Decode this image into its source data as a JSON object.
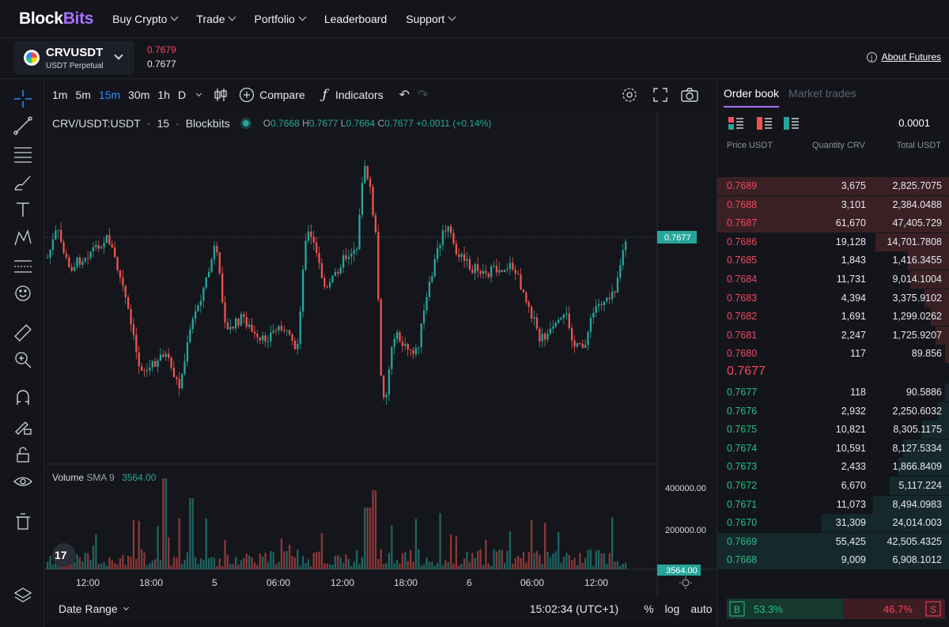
{
  "nav": {
    "logo_a": "Block",
    "logo_b": "Bits",
    "items": [
      "Buy Crypto",
      "Trade",
      "Portfolio",
      "Leaderboard",
      "Support"
    ]
  },
  "symbol": {
    "name": "CRVUSDT",
    "sub": "USDT Perpetual",
    "last_price": "0.7679",
    "mark_price": "0.7677",
    "about": "About Futures"
  },
  "toolbar": {
    "timeframes": [
      "1m",
      "5m",
      "15m",
      "30m",
      "1h",
      "D"
    ],
    "active_timeframe": "15m",
    "compare": "Compare",
    "indicators": "Indicators"
  },
  "chart": {
    "title": "CRV/USDT:USDT",
    "interval": "15",
    "source": "Blockbits",
    "ohlc": {
      "o": "0.7668",
      "h": "0.7677",
      "l": "0.7664",
      "c": "0.7677",
      "chg": "+0.0011",
      "pct": "(+0.14%)"
    },
    "price_tag": "0.7677",
    "volume_label": "Volume",
    "sma_label": "SMA 9",
    "sma_value": "3564.00",
    "vol_ticks": [
      "400000.00",
      "200000.00"
    ],
    "vol_tag": "3564.00",
    "time_labels": [
      "12:00",
      "18:00",
      "5",
      "06:00",
      "12:00",
      "18:00",
      "6",
      "06:00",
      "12:00"
    ],
    "tv_logo": "17",
    "colors": {
      "up": "#26a69a",
      "down": "#ef5350"
    }
  },
  "chart_bottom": {
    "date_range": "Date Range",
    "clock": "15:02:34 (UTC+1)",
    "pct": "%",
    "log": "log",
    "auto": "auto"
  },
  "orderbook": {
    "tab_active": "Order book",
    "tab_inactive": "Market trades",
    "tick": "0.0001",
    "headers": {
      "price": "Price USDT",
      "qty": "Quantity CRV",
      "total": "Total USDT"
    },
    "asks": [
      {
        "p": "0.7689",
        "q": "3,675",
        "t": "2,825.7075",
        "d": 1.0
      },
      {
        "p": "0.7688",
        "q": "3,101",
        "t": "2,384.0488",
        "d": 1.0
      },
      {
        "p": "0.7687",
        "q": "61,670",
        "t": "47,405.729",
        "d": 1.0
      },
      {
        "p": "0.7686",
        "q": "19,128",
        "t": "14,701.7808",
        "d": 0.32
      },
      {
        "p": "0.7685",
        "q": "1,843",
        "t": "1,416.3455",
        "d": 0.18
      },
      {
        "p": "0.7684",
        "q": "11,731",
        "t": "9,014.1004",
        "d": 0.17
      },
      {
        "p": "0.7683",
        "q": "4,394",
        "t": "3,375.9102",
        "d": 0.11
      },
      {
        "p": "0.7682",
        "q": "1,691",
        "t": "1,299.0262",
        "d": 0.08
      },
      {
        "p": "0.7681",
        "q": "2,247",
        "t": "1,725.9207",
        "d": 0.06
      },
      {
        "p": "0.7680",
        "q": "117",
        "t": "89.856",
        "d": 0.02
      }
    ],
    "mid_price": "0.7677",
    "bids": [
      {
        "p": "0.7677",
        "q": "118",
        "t": "90.5886",
        "d": 0.02
      },
      {
        "p": "0.7676",
        "q": "2,932",
        "t": "2,250.6032",
        "d": 0.05
      },
      {
        "p": "0.7675",
        "q": "10,821",
        "t": "8,305.1175",
        "d": 0.12
      },
      {
        "p": "0.7674",
        "q": "10,591",
        "t": "8,127.5334",
        "d": 0.2
      },
      {
        "p": "0.7673",
        "q": "2,433",
        "t": "1,866.8409",
        "d": 0.22
      },
      {
        "p": "0.7672",
        "q": "6,670",
        "t": "5,117.224",
        "d": 0.26
      },
      {
        "p": "0.7671",
        "q": "11,073",
        "t": "8,494.0983",
        "d": 0.33
      },
      {
        "p": "0.7670",
        "q": "31,309",
        "t": "24,014.003",
        "d": 0.55
      },
      {
        "p": "0.7669",
        "q": "55,425",
        "t": "42,505.4325",
        "d": 1.0
      },
      {
        "p": "0.7668",
        "q": "9,009",
        "t": "6,908.1012",
        "d": 1.0
      }
    ],
    "buy_label": "B",
    "buy_pct": "53.3%",
    "sell_pct": "46.7%",
    "sell_label": "S",
    "buy_ratio": 0.533
  }
}
